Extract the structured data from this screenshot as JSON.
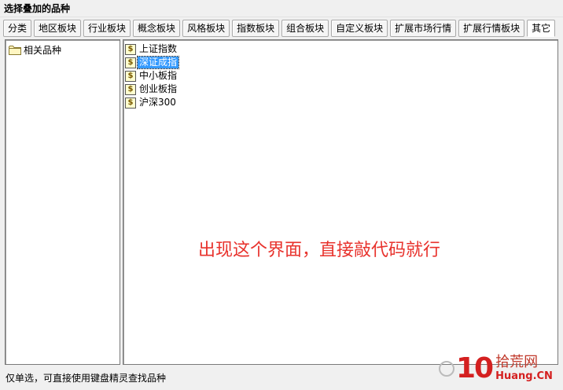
{
  "window": {
    "title": "选择叠加的品种"
  },
  "tabs": [
    {
      "label": "分类"
    },
    {
      "label": "地区板块"
    },
    {
      "label": "行业板块"
    },
    {
      "label": "概念板块"
    },
    {
      "label": "风格板块"
    },
    {
      "label": "指数板块"
    },
    {
      "label": "组合板块"
    },
    {
      "label": "自定义板块"
    },
    {
      "label": "扩展市场行情"
    },
    {
      "label": "扩展行情板块"
    },
    {
      "label": "其它"
    }
  ],
  "active_tab": "其它",
  "tree": {
    "items": [
      {
        "label": "相关品种",
        "icon": "folder-icon"
      }
    ]
  },
  "list": {
    "items": [
      {
        "label": "上证指数",
        "icon": "dollar-icon"
      },
      {
        "label": "深证成指",
        "icon": "dollar-icon",
        "selected": true
      },
      {
        "label": "中小板指",
        "icon": "dollar-icon"
      },
      {
        "label": "创业板指",
        "icon": "dollar-icon"
      },
      {
        "label": "沪深300",
        "icon": "dollar-icon"
      }
    ]
  },
  "annotation": {
    "text": "出现这个界面，直接敲代码就行"
  },
  "status": {
    "text": "仅单选，可直接使用键盘精灵查找品种"
  },
  "watermark": {
    "number": "10",
    "cn": "拾荒网",
    "en": "Huang.CN"
  },
  "colors": {
    "selected_bg": "#3399ff",
    "annotation": "#e8322c",
    "watermark_red": "#d42020"
  }
}
